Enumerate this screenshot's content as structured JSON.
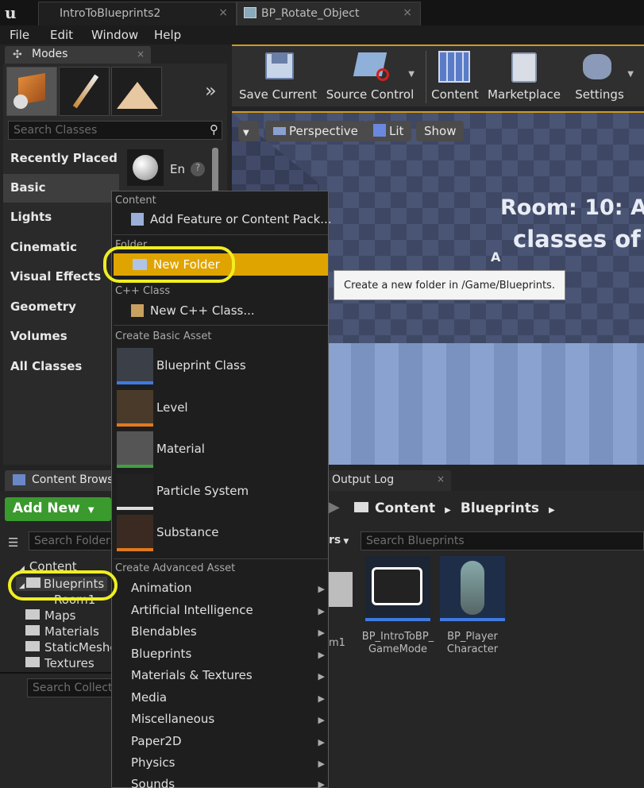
{
  "tabs": [
    {
      "label": "IntroToBlueprints2"
    },
    {
      "label": "BP_Rotate_Object"
    }
  ],
  "menu": [
    "File",
    "Edit",
    "Window",
    "Help"
  ],
  "modes": {
    "title": "Modes",
    "search_placeholder": "Search Classes",
    "categories": [
      "Recently Placed",
      "Basic",
      "Lights",
      "Cinematic",
      "Visual Effects",
      "Geometry",
      "Volumes",
      "All Classes"
    ],
    "item_label": "En"
  },
  "toolbar": {
    "save": "Save Current",
    "source": "Source Control",
    "content": "Content",
    "marketplace": "Marketplace",
    "settings": "Settings"
  },
  "viewport": {
    "perspective": "Perspective",
    "lit": "Lit",
    "show": "Show",
    "line1": "Room: 10: A",
    "line2": "classes of",
    "marker": "A"
  },
  "content_browser": {
    "tab": "Content Browser",
    "output_tab": "Output Log",
    "add_new": "Add New",
    "search_folders": "Search Folders",
    "search_collections": "Search Collections",
    "search_assets": "Search Blueprints",
    "filters_frag": "rs",
    "path": [
      "Content",
      "Blueprints"
    ],
    "tree": [
      "Content",
      "Blueprints",
      "Room1",
      "Maps",
      "Materials",
      "StaticMeshes",
      "Textures"
    ],
    "partial_asset": "m1",
    "assets": [
      {
        "line1": "BP_IntroToBP_",
        "line2": "GameMode"
      },
      {
        "line1": "BP_Player",
        "line2": "Character"
      }
    ]
  },
  "context_menu": {
    "sections": {
      "content": "Content",
      "folder": "Folder",
      "cpp": "C++ Class",
      "basic": "Create Basic Asset",
      "advanced": "Create Advanced Asset"
    },
    "add_feature": "Add Feature or Content Pack...",
    "new_folder": "New Folder",
    "new_cpp": "New C++ Class...",
    "basic_assets": [
      "Blueprint Class",
      "Level",
      "Material",
      "Particle System",
      "Substance"
    ],
    "advanced_assets": [
      "Animation",
      "Artificial Intelligence",
      "Blendables",
      "Blueprints",
      "Materials & Textures",
      "Media",
      "Miscellaneous",
      "Paper2D",
      "Physics",
      "Sounds"
    ]
  },
  "tooltip": "Create a new folder in /Game/Blueprints.",
  "colors": {
    "accent": "#d09a20",
    "highlight": "#f0ee20",
    "add_new": "#3a9a2e",
    "selected_menu": "#e0a400"
  }
}
